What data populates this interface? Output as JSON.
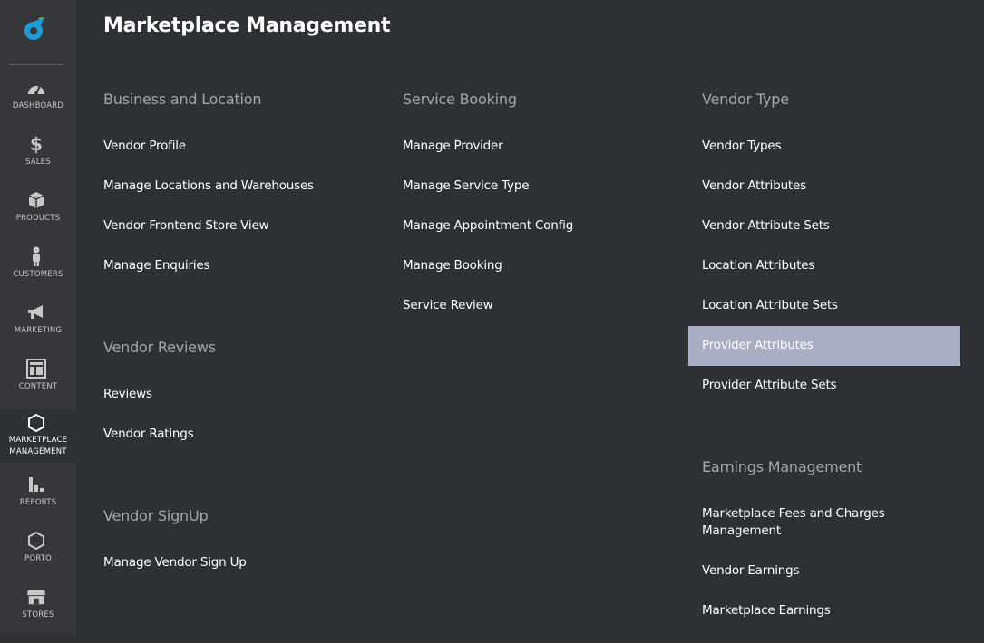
{
  "nav": {
    "dashboard": "Dashboard",
    "sales": "Sales",
    "products": "Products",
    "customers": "Customers",
    "marketing": "Marketing",
    "content": "Content",
    "marketplace_1": "Marketplace",
    "marketplace_2": "Management",
    "reports": "Reports",
    "porto": "Porto",
    "stores": "Stores"
  },
  "page": {
    "title": "Marketplace Management"
  },
  "sections": {
    "business": {
      "title": "Business and Location",
      "links": [
        "Vendor Profile",
        "Manage Locations and Warehouses",
        "Vendor Frontend Store View",
        "Manage Enquiries"
      ]
    },
    "reviews": {
      "title": "Vendor Reviews",
      "links": [
        "Reviews",
        "Vendor Ratings"
      ]
    },
    "signup": {
      "title": "Vendor SignUp",
      "links": [
        "Manage Vendor Sign Up"
      ]
    },
    "service": {
      "title": "Service Booking",
      "links": [
        "Manage Provider",
        "Manage Service Type",
        "Manage Appointment Config",
        "Manage Booking",
        "Service Review"
      ]
    },
    "vendor_type": {
      "title": "Vendor Type",
      "links": [
        "Vendor Types",
        "Vendor Attributes",
        "Vendor Attribute Sets",
        "Location Attributes",
        "Location Attribute Sets",
        "Provider Attributes",
        "Provider Attribute Sets"
      ]
    },
    "earnings": {
      "title": "Earnings Management",
      "links": [
        "Marketplace Fees and Charges Management",
        "Vendor Earnings",
        "Marketplace Earnings"
      ]
    }
  },
  "colors": {
    "highlight": "#a9aec5",
    "accent_blue": "#1e9ad6",
    "accent_green": "#8cc63f"
  }
}
